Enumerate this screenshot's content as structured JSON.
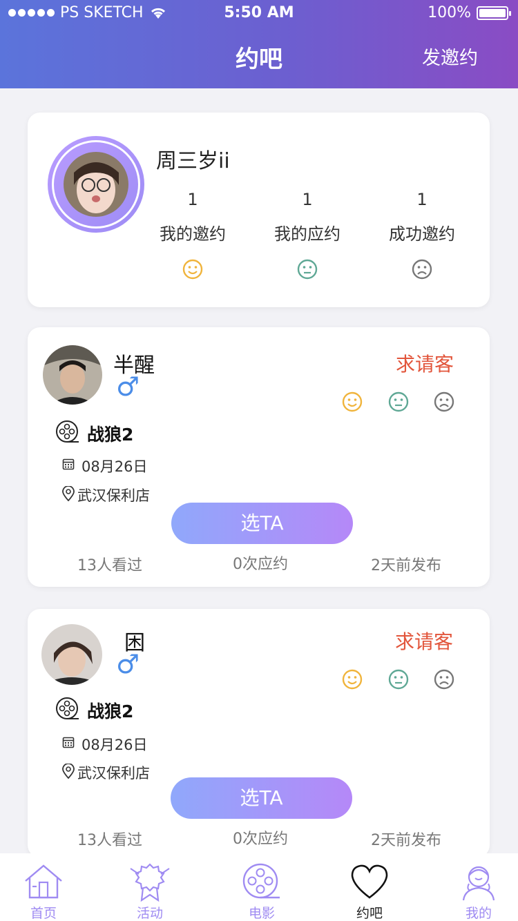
{
  "status": {
    "carrier": "PS SKETCH",
    "time": "5:50 AM",
    "battery": "100%"
  },
  "header": {
    "title": "约吧",
    "action": "发邀约"
  },
  "profile": {
    "name": "周三岁ii",
    "stats": [
      {
        "count": "1",
        "label": "我的邀约"
      },
      {
        "count": "1",
        "label": "我的应约"
      },
      {
        "count": "1",
        "label": "成功邀约"
      }
    ]
  },
  "posts": [
    {
      "name": "半醒",
      "tag": "求请客",
      "movie": "战狼2",
      "date": "08月26日",
      "location": "武汉保利店",
      "button": "选TA",
      "viewed": "13人看过",
      "responses": "0次应约",
      "posted": "2天前发布"
    },
    {
      "name": "困",
      "tag": "求请客",
      "movie": "战狼2",
      "date": "08月26日",
      "location": "武汉保利店",
      "button": "选TA",
      "viewed": "13人看过",
      "responses": "0次应约",
      "posted": "2天前发布"
    }
  ],
  "tabs": [
    {
      "label": "首页",
      "icon": "home-icon"
    },
    {
      "label": "活动",
      "icon": "ribbon-icon"
    },
    {
      "label": "电影",
      "icon": "film-reel-icon"
    },
    {
      "label": "约吧",
      "icon": "heart-icon"
    },
    {
      "label": "我的",
      "icon": "user-icon"
    }
  ],
  "colors": {
    "accent": "#9f8bf2",
    "tag": "#e2553b",
    "male": "#4b8de8",
    "happy": "#f0b43c",
    "neutral": "#5fa895",
    "sad": "#777777"
  }
}
